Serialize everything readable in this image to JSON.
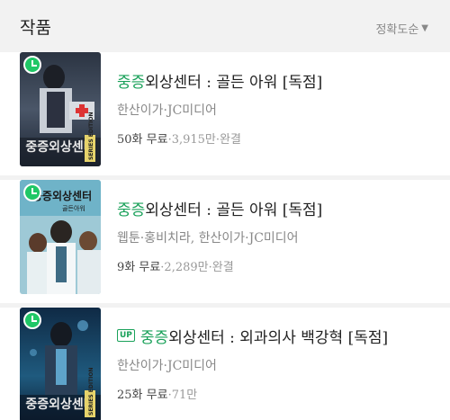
{
  "header": {
    "title": "작품",
    "sort_label": "정확도순",
    "sort_icon": "triangle-down-icon"
  },
  "colors": {
    "accent_green": "#1aa15a",
    "badge_green": "#1fc766",
    "background": "#f2f2f2"
  },
  "items": [
    {
      "title_prefix": "중증",
      "title_rest": "외상센터 : 골든 아워 [독점]",
      "up": false,
      "author": "한산이가·JC미디어",
      "episodes": "50화 무료",
      "views": "·3,915만·완결",
      "thumb_title": "중증외상센터",
      "thumb_badge": "SERIES EDITION"
    },
    {
      "title_prefix": "중증",
      "title_rest": "외상센터 : 골든 아워 [독점]",
      "up": false,
      "author": "웹툰·홍비치라, 한산이가·JC미디어",
      "episodes": "9화 무료",
      "views": "·2,289만·완결",
      "thumb_title": "중증외상센터",
      "thumb_subtitle": "골든아워",
      "thumb_badge": ""
    },
    {
      "title_prefix": "중증",
      "title_rest": "외상센터 : 외과의사 백강혁 [독점]",
      "up": true,
      "up_label": "UP",
      "author": "한산이가·JC미디어",
      "episodes": "25화 무료",
      "views": "·71만",
      "thumb_title": "중증외상센터",
      "thumb_badge": "SERIES EDITION"
    }
  ]
}
